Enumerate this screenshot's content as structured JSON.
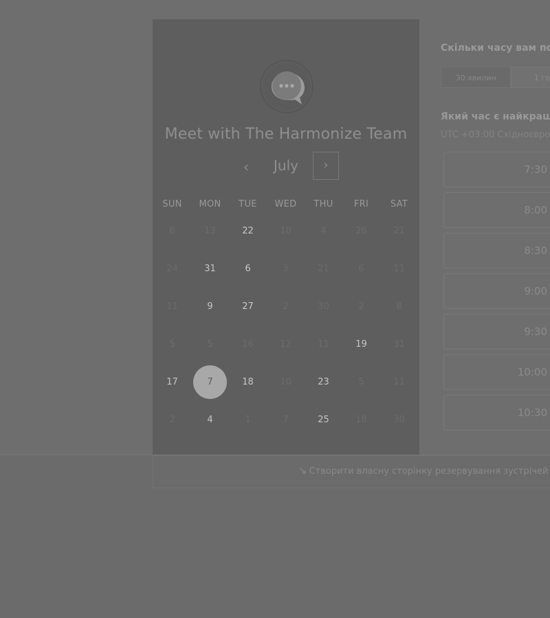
{
  "booking": {
    "title": "Meet with The Harmonize Team",
    "logo_icon": "chat-bubble-icon"
  },
  "calendar": {
    "month": "July",
    "prev_icon": "‹",
    "next_icon": "›",
    "weekdays": [
      "SUN",
      "MON",
      "TUE",
      "WED",
      "THU",
      "FRI",
      "SAT"
    ],
    "weeks": [
      [
        {
          "d": "6",
          "s": "disabled"
        },
        {
          "d": "13",
          "s": "disabled"
        },
        {
          "d": "22",
          "s": "avail"
        },
        {
          "d": "10",
          "s": "disabled"
        },
        {
          "d": "4",
          "s": "disabled"
        },
        {
          "d": "26",
          "s": "disabled"
        },
        {
          "d": "21",
          "s": "disabled"
        }
      ],
      [
        {
          "d": "24",
          "s": "disabled"
        },
        {
          "d": "31",
          "s": "avail"
        },
        {
          "d": "6",
          "s": "avail"
        },
        {
          "d": "3",
          "s": "disabled"
        },
        {
          "d": "21",
          "s": "disabled"
        },
        {
          "d": "6",
          "s": "disabled"
        },
        {
          "d": "11",
          "s": "disabled"
        }
      ],
      [
        {
          "d": "11",
          "s": "disabled"
        },
        {
          "d": "9",
          "s": "avail"
        },
        {
          "d": "27",
          "s": "avail"
        },
        {
          "d": "2",
          "s": "disabled"
        },
        {
          "d": "30",
          "s": "disabled"
        },
        {
          "d": "2",
          "s": "disabled"
        },
        {
          "d": "8",
          "s": "disabled"
        }
      ],
      [
        {
          "d": "5",
          "s": "disabled"
        },
        {
          "d": "5",
          "s": "disabled"
        },
        {
          "d": "16",
          "s": "disabled"
        },
        {
          "d": "12",
          "s": "disabled"
        },
        {
          "d": "11",
          "s": "disabled"
        },
        {
          "d": "19",
          "s": "avail"
        },
        {
          "d": "31",
          "s": "disabled"
        }
      ],
      [
        {
          "d": "17",
          "s": "avail"
        },
        {
          "d": "7",
          "s": "selected"
        },
        {
          "d": "18",
          "s": "avail"
        },
        {
          "d": "10",
          "s": "disabled"
        },
        {
          "d": "23",
          "s": "avail"
        },
        {
          "d": "5",
          "s": "disabled"
        },
        {
          "d": "11",
          "s": "disabled"
        }
      ],
      [
        {
          "d": "2",
          "s": "disabled"
        },
        {
          "d": "4",
          "s": "avail"
        },
        {
          "d": "1",
          "s": "disabled"
        },
        {
          "d": "7",
          "s": "disabled"
        },
        {
          "d": "25",
          "s": "avail"
        },
        {
          "d": "18",
          "s": "disabled"
        },
        {
          "d": "30",
          "s": "disabled"
        }
      ]
    ]
  },
  "duration": {
    "heading": "Скільки часу вам по",
    "options": [
      "30 хвилин",
      "1 год"
    ]
  },
  "times": {
    "heading": "Який час є найкращи",
    "timezone": "UTC +03:00 Східноєвро",
    "slots": [
      "7:30",
      "8:00",
      "8:30",
      "9:00",
      "9:30",
      "10:00",
      "10:30"
    ]
  },
  "footer": {
    "link_label": "Створити власну сторінку резервування зустрічей",
    "link_icon": "↘"
  }
}
